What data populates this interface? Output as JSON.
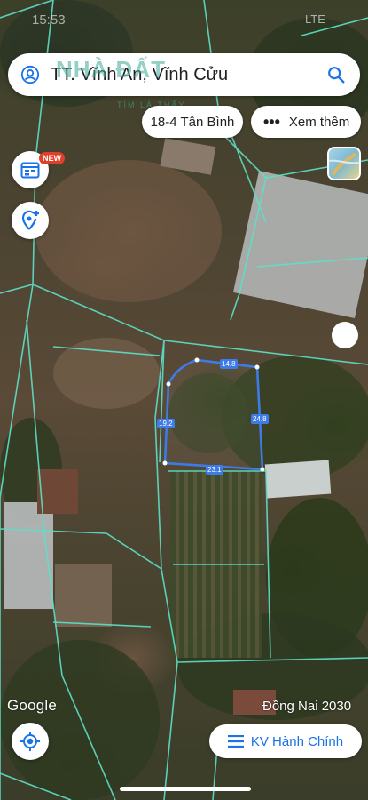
{
  "status_bar": {
    "time": "15:53",
    "carrier": "LTE"
  },
  "search": {
    "query": "TT. Vĩnh An, Vĩnh Cửu"
  },
  "chips": [
    {
      "label": "18-4 Tân Bình"
    },
    {
      "label": "Xem thêm"
    }
  ],
  "badges": {
    "new": "NEW"
  },
  "watermark": {
    "logo": "NHÀ ĐẤT",
    "sub": "TÌM LÀ THẤY"
  },
  "measurements": {
    "top": "14.8",
    "right": "24.8",
    "bottom": "23.1",
    "left": "19.2"
  },
  "map": {
    "attribution": "Google",
    "plan_label": "Đồng Nai 2030"
  },
  "admin_button": {
    "label": "KV Hành Chính"
  },
  "colors": {
    "accent": "#1a73e8",
    "parcel_line": "#5ee0c8",
    "selection": "#3d7be8",
    "badge": "#e0402a"
  },
  "icons": [
    "user-icon",
    "search-icon",
    "calendar-icon",
    "add-location-icon",
    "layers-icon",
    "my-location-icon",
    "menu-icon",
    "more-icon"
  ]
}
